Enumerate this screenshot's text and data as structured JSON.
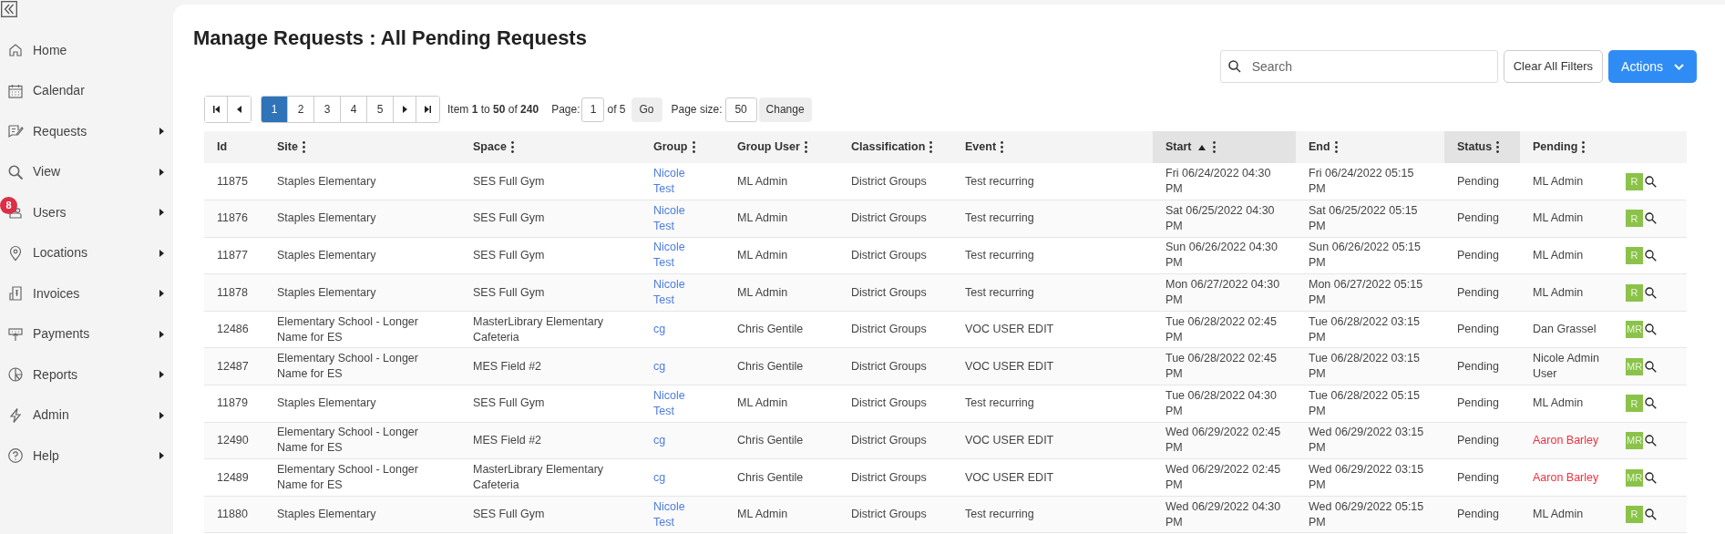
{
  "sidebar": {
    "items": [
      {
        "label": "Home",
        "has_submenu": false
      },
      {
        "label": "Calendar",
        "has_submenu": false
      },
      {
        "label": "Requests",
        "has_submenu": true
      },
      {
        "label": "View",
        "has_submenu": true
      },
      {
        "label": "Users",
        "has_submenu": true,
        "badge": "8"
      },
      {
        "label": "Locations",
        "has_submenu": true
      },
      {
        "label": "Invoices",
        "has_submenu": true
      },
      {
        "label": "Payments",
        "has_submenu": true
      },
      {
        "label": "Reports",
        "has_submenu": true
      },
      {
        "label": "Admin",
        "has_submenu": true
      },
      {
        "label": "Help",
        "has_submenu": true
      }
    ]
  },
  "title": "Manage Requests : All Pending Requests",
  "toolbar": {
    "search": {
      "placeholder": "Search"
    },
    "clear_button": "Clear All Filters",
    "actions_button": "Actions"
  },
  "pager": {
    "pages": [
      {
        "label": "1",
        "selected": true
      },
      {
        "label": "2",
        "selected": false
      },
      {
        "label": "3",
        "selected": false
      },
      {
        "label": "4",
        "selected": false
      },
      {
        "label": "5",
        "selected": false
      }
    ],
    "summary": "Item **1** to **50** of **240**",
    "page_label": "Page:",
    "page_value": "1",
    "page_of": "of 5",
    "go_button": "Go",
    "size_label": "Page size:",
    "size_value": "50",
    "change_button": "Change"
  },
  "table": {
    "columns": [
      {
        "label": "Id",
        "menu": false,
        "highlighted": false,
        "sorted_ascending": false
      },
      {
        "label": "Site",
        "menu": true,
        "highlighted": false,
        "sorted_ascending": false
      },
      {
        "label": "Space",
        "menu": true,
        "highlighted": false,
        "sorted_ascending": false
      },
      {
        "label": "Group",
        "menu": true,
        "highlighted": false,
        "sorted_ascending": false
      },
      {
        "label": "Group User",
        "menu": true,
        "highlighted": false,
        "sorted_ascending": false
      },
      {
        "label": "Classification",
        "menu": true,
        "highlighted": false,
        "sorted_ascending": false
      },
      {
        "label": "Event",
        "menu": true,
        "highlighted": false,
        "sorted_ascending": false
      },
      {
        "label": "Start",
        "menu": true,
        "highlighted": true,
        "sorted_ascending": true
      },
      {
        "label": "End",
        "menu": true,
        "highlighted": false,
        "sorted_ascending": false
      },
      {
        "label": "Status",
        "menu": true,
        "highlighted": true,
        "sorted_ascending": false
      },
      {
        "label": "Pending",
        "menu": true,
        "highlighted": false,
        "sorted_ascending": false
      }
    ],
    "rows": [
      {
        "id": "11875",
        "site": "Staples Elementary",
        "space": "SES Full Gym",
        "group": "Nicole Test",
        "group_user": "ML Admin",
        "classification": "District Groups",
        "event": "Test recurring",
        "start": "Fri 06/24/2022 04:30 PM",
        "end": "Fri 06/24/2022 05:15 PM",
        "status": "Pending",
        "pending": "ML Admin",
        "pending_alert": false,
        "tag": "R"
      },
      {
        "id": "11876",
        "site": "Staples Elementary",
        "space": "SES Full Gym",
        "group": "Nicole Test",
        "group_user": "ML Admin",
        "classification": "District Groups",
        "event": "Test recurring",
        "start": "Sat 06/25/2022 04:30 PM",
        "end": "Sat 06/25/2022 05:15 PM",
        "status": "Pending",
        "pending": "ML Admin",
        "pending_alert": false,
        "tag": "R"
      },
      {
        "id": "11877",
        "site": "Staples Elementary",
        "space": "SES Full Gym",
        "group": "Nicole Test",
        "group_user": "ML Admin",
        "classification": "District Groups",
        "event": "Test recurring",
        "start": "Sun 06/26/2022 04:30 PM",
        "end": "Sun 06/26/2022 05:15 PM",
        "status": "Pending",
        "pending": "ML Admin",
        "pending_alert": false,
        "tag": "R"
      },
      {
        "id": "11878",
        "site": "Staples Elementary",
        "space": "SES Full Gym",
        "group": "Nicole Test",
        "group_user": "ML Admin",
        "classification": "District Groups",
        "event": "Test recurring",
        "start": "Mon 06/27/2022 04:30 PM",
        "end": "Mon 06/27/2022 05:15 PM",
        "status": "Pending",
        "pending": "ML Admin",
        "pending_alert": false,
        "tag": "R"
      },
      {
        "id": "12486",
        "site": "Elementary School - Longer Name for ES",
        "space": "MasterLibrary Elementary Cafeteria",
        "group": "cg",
        "group_user": "Chris Gentile",
        "classification": "District Groups",
        "event": "VOC USER EDIT",
        "start": "Tue 06/28/2022 02:45 PM",
        "end": "Tue 06/28/2022 03:15 PM",
        "status": "Pending",
        "pending": "Dan Grassel",
        "pending_alert": false,
        "tag": "MR"
      },
      {
        "id": "12487",
        "site": "Elementary School - Longer Name for ES",
        "space": "MES Field #2",
        "group": "cg",
        "group_user": "Chris Gentile",
        "classification": "District Groups",
        "event": "VOC USER EDIT",
        "start": "Tue 06/28/2022 02:45 PM",
        "end": "Tue 06/28/2022 03:15 PM",
        "status": "Pending",
        "pending": "Nicole Admin User",
        "pending_alert": false,
        "tag": "MR"
      },
      {
        "id": "11879",
        "site": "Staples Elementary",
        "space": "SES Full Gym",
        "group": "Nicole Test",
        "group_user": "ML Admin",
        "classification": "District Groups",
        "event": "Test recurring",
        "start": "Tue 06/28/2022 04:30 PM",
        "end": "Tue 06/28/2022 05:15 PM",
        "status": "Pending",
        "pending": "ML Admin",
        "pending_alert": false,
        "tag": "R"
      },
      {
        "id": "12490",
        "site": "Elementary School - Longer Name for ES",
        "space": "MES Field #2",
        "group": "cg",
        "group_user": "Chris Gentile",
        "classification": "District Groups",
        "event": "VOC USER EDIT",
        "start": "Wed 06/29/2022 02:45 PM",
        "end": "Wed 06/29/2022 03:15 PM",
        "status": "Pending",
        "pending": "Aaron Barley",
        "pending_alert": true,
        "tag": "MR"
      },
      {
        "id": "12489",
        "site": "Elementary School - Longer Name for ES",
        "space": "MasterLibrary Elementary Cafeteria",
        "group": "cg",
        "group_user": "Chris Gentile",
        "classification": "District Groups",
        "event": "VOC USER EDIT",
        "start": "Wed 06/29/2022 02:45 PM",
        "end": "Wed 06/29/2022 03:15 PM",
        "status": "Pending",
        "pending": "Aaron Barley",
        "pending_alert": true,
        "tag": "MR"
      },
      {
        "id": "11880",
        "site": "Staples Elementary",
        "space": "SES Full Gym",
        "group": "Nicole Test",
        "group_user": "ML Admin",
        "classification": "District Groups",
        "event": "Test recurring",
        "start": "Wed 06/29/2022 04:30 PM",
        "end": "Wed 06/29/2022 05:15 PM",
        "status": "Pending",
        "pending": "ML Admin",
        "pending_alert": false,
        "tag": "R"
      }
    ]
  }
}
